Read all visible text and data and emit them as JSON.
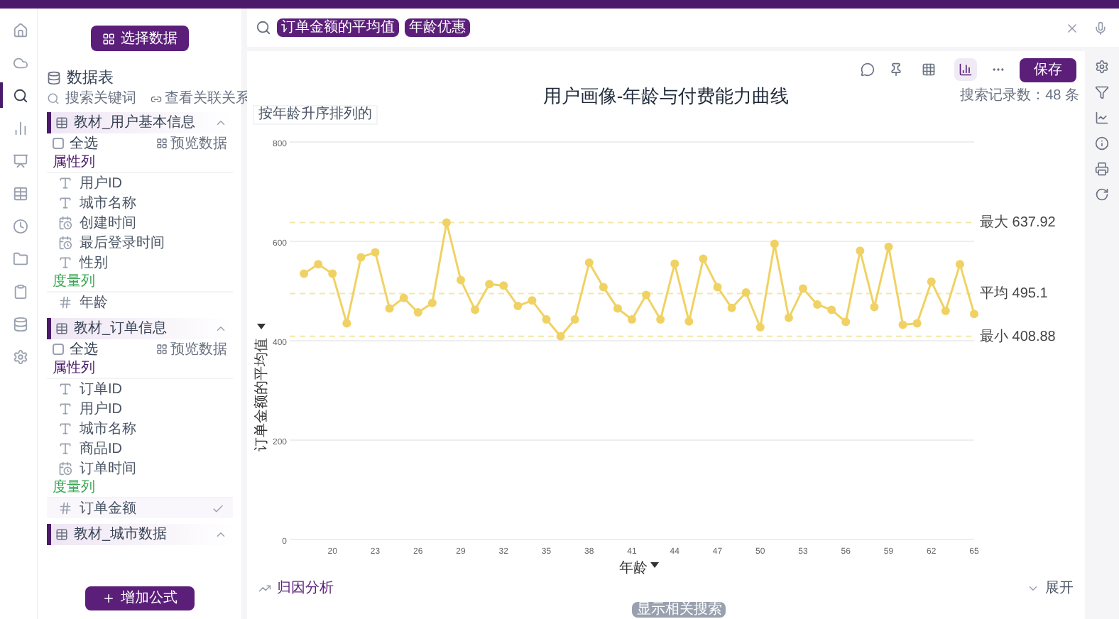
{
  "nav_rail": [
    {
      "selected": false
    },
    {
      "selected": false
    },
    {
      "selected": true
    },
    {
      "selected": false
    },
    {
      "selected": false
    },
    {
      "selected": false
    },
    {
      "selected": false
    },
    {
      "selected": false
    },
    {
      "selected": false
    },
    {
      "selected": false
    },
    {
      "selected": false
    }
  ],
  "sidebar": {
    "select_button": "选择数据",
    "heading": "数据表",
    "search": {
      "placeholder": "搜索关键词"
    },
    "relation_link": "查看关联关系",
    "tables": [
      {
        "name": "教材_用户基本信息",
        "expanded": true,
        "select_all": "全选",
        "select_all_checked": false,
        "preview": "预览数据",
        "sections": [
          {
            "label": "属性列",
            "kind": "attribute",
            "items": [
              {
                "name": "用户ID",
                "kind": "text",
                "selected": false
              },
              {
                "name": "城市名称",
                "kind": "text",
                "selected": false
              },
              {
                "name": "创建时间",
                "kind": "time",
                "selected": false
              },
              {
                "name": "最后登录时间",
                "kind": "time",
                "selected": false
              },
              {
                "name": "性别",
                "kind": "text",
                "selected": false
              }
            ]
          },
          {
            "label": "度量列",
            "kind": "measure",
            "items": [
              {
                "name": "年龄",
                "kind": "number",
                "selected": false
              }
            ]
          }
        ]
      },
      {
        "name": "教材_订单信息",
        "expanded": true,
        "select_all": "全选",
        "select_all_checked": false,
        "preview": "预览数据",
        "sections": [
          {
            "label": "属性列",
            "kind": "attribute",
            "items": [
              {
                "name": "订单ID",
                "kind": "text",
                "selected": false
              },
              {
                "name": "用户ID",
                "kind": "text",
                "selected": false
              },
              {
                "name": "城市名称",
                "kind": "text",
                "selected": false
              },
              {
                "name": "商品ID",
                "kind": "text",
                "selected": false
              },
              {
                "name": "订单时间",
                "kind": "time",
                "selected": false
              }
            ]
          },
          {
            "label": "度量列",
            "kind": "measure",
            "items": [
              {
                "name": "订单金额",
                "kind": "number",
                "selected": true
              }
            ]
          }
        ]
      },
      {
        "name": "教材_城市数据",
        "expanded": true
      }
    ],
    "add_formula_button": "增加公式"
  },
  "search_bar": {
    "tags": [
      "订单金额的平均值",
      "年龄优惠"
    ]
  },
  "result": {
    "view_toggle": [
      {
        "selected": false
      },
      {
        "selected": true
      }
    ],
    "save_button": "保存",
    "title": "用户画像-年龄与付费能力曲线",
    "record_count": "搜索记录数：48 条",
    "sort_chip": "按年龄升序排列的",
    "chart_data": {
      "type": "line",
      "xlabel": "年龄",
      "ylabel": "订单金额的平均值",
      "x": [
        18,
        19,
        20,
        21,
        22,
        23,
        24,
        25,
        26,
        27,
        28,
        29,
        30,
        31,
        32,
        33,
        34,
        35,
        36,
        37,
        38,
        39,
        40,
        41,
        42,
        43,
        44,
        45,
        46,
        47,
        48,
        49,
        50,
        51,
        52,
        53,
        54,
        55,
        56,
        57,
        58,
        59,
        60,
        61,
        62,
        63,
        64,
        65
      ],
      "series": [
        {
          "color": "#f0d264",
          "marker": "o",
          "values": [
            535,
            554,
            535,
            435,
            568,
            578,
            465,
            486,
            457,
            476,
            638,
            522,
            462,
            514,
            511,
            470,
            481,
            443,
            409,
            443,
            557,
            508,
            465,
            443,
            492,
            443,
            555,
            439,
            565,
            508,
            466,
            497,
            427,
            595,
            446,
            505,
            473,
            462,
            438,
            581,
            468,
            589,
            432,
            435,
            519,
            460,
            554,
            454
          ]
        }
      ],
      "xlim": [
        17,
        65
      ],
      "ylim": [
        0,
        800
      ],
      "yticks": [
        0,
        200,
        400,
        600,
        800
      ],
      "xticks": [
        20,
        23,
        26,
        29,
        32,
        35,
        38,
        41,
        44,
        47,
        50,
        53,
        56,
        59,
        62,
        65
      ],
      "grid": true,
      "ref_lines": [
        {
          "axis": "y",
          "value": 637.92,
          "label": "最大 637.92",
          "color": "#f3e7a8"
        },
        {
          "axis": "y",
          "value": 495.1,
          "label": "平均 495.1",
          "color": "#f3e7a8"
        },
        {
          "axis": "y",
          "value": 408.88,
          "label": "最小 408.88",
          "color": "#f3e7a8"
        }
      ]
    }
  },
  "footer": {
    "attribution": "归因分析",
    "expand": "展开",
    "related_search": "显示相关搜索"
  }
}
